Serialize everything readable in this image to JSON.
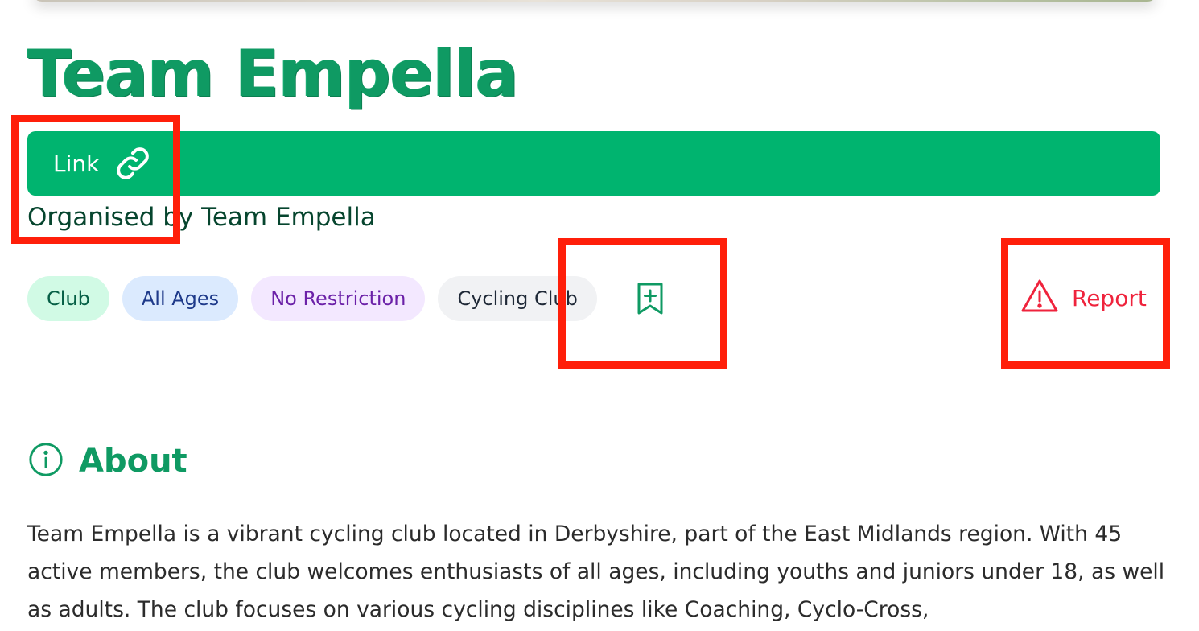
{
  "club": {
    "title": "Team Empella",
    "link_label": "Link",
    "organiser_text": "Organised by Team Empella"
  },
  "tags": [
    "Club",
    "All Ages",
    "No Restriction",
    "Cycling Club"
  ],
  "actions": {
    "bookmark_icon": "bookmark-plus-icon",
    "report_label": "Report",
    "report_icon": "warning-triangle-icon"
  },
  "about": {
    "heading": "About",
    "icon": "info-icon",
    "text": "Team Empella is a vibrant cycling club located in Derbyshire, part of the East Midlands region. With 45 active members, the club welcomes enthusiasts of all ages, including youths and juniors under 18, as well as adults. The club focuses on various cycling disciplines like Coaching, Cyclo-Cross,"
  },
  "colors": {
    "brand_green": "#00b46f",
    "title_green": "#0f9a63",
    "report_red": "#ef233c",
    "highlight_red": "#ff1f0a"
  }
}
